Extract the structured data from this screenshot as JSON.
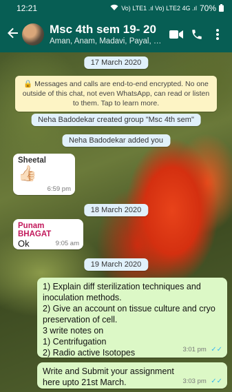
{
  "status_bar": {
    "time": "12:21",
    "network": "Vo) LTE1 .ıl Vo) LTE2 4G .ıl",
    "battery": "70%"
  },
  "header": {
    "title": "Msc 4th sem 19- 20",
    "subtitle": "Aman, Anam, Madavi, Payal, Pun..."
  },
  "icons": {
    "back": "arrow-left-icon",
    "video": "video-call-icon",
    "call": "phone-icon",
    "menu": "more-vert-icon"
  },
  "colors": {
    "header": "#075e54",
    "outgoing_bubble": "#dcf8c6",
    "incoming_bubble": "#ffffff",
    "date_chip": "#e1f1fb",
    "encryption_notice": "#fdf4c5",
    "read_ticks": "#34b7f1",
    "sender_sheetal": "#333333",
    "sender_punam": "#c2185b"
  },
  "chat": {
    "date_1": "17 March 2020",
    "encryption_notice": "🔒 Messages and calls are end-to-end encrypted. No one outside of this chat, not even WhatsApp, can read or listen to them. Tap to learn more.",
    "system_1": "Neha Badodekar created group \"Msc 4th sem\"",
    "system_2": "Neha Badodekar added you",
    "msg_1": {
      "sender": "Sheetal",
      "emoji": "👍🏻",
      "time": "6:59 pm"
    },
    "date_2": "18 March 2020",
    "msg_2": {
      "sender": "Punam BHAGAT",
      "text": "Ok",
      "time": "9:05 am"
    },
    "date_3": "19 March 2020",
    "msg_3": {
      "text": "1) Explain diff sterilization techniques and inoculation methods.\n2) Give an account on tissue culture and cryo preservation of cell.\n3 write notes on\n1) Centrifugation\n2) Radio active Isotopes",
      "time": "3:01 pm",
      "ticks": "✓✓"
    },
    "msg_4": {
      "text": "Write and Submit your  assignment here upto 21st March.",
      "time": "3:03 pm",
      "ticks": "✓✓"
    }
  }
}
